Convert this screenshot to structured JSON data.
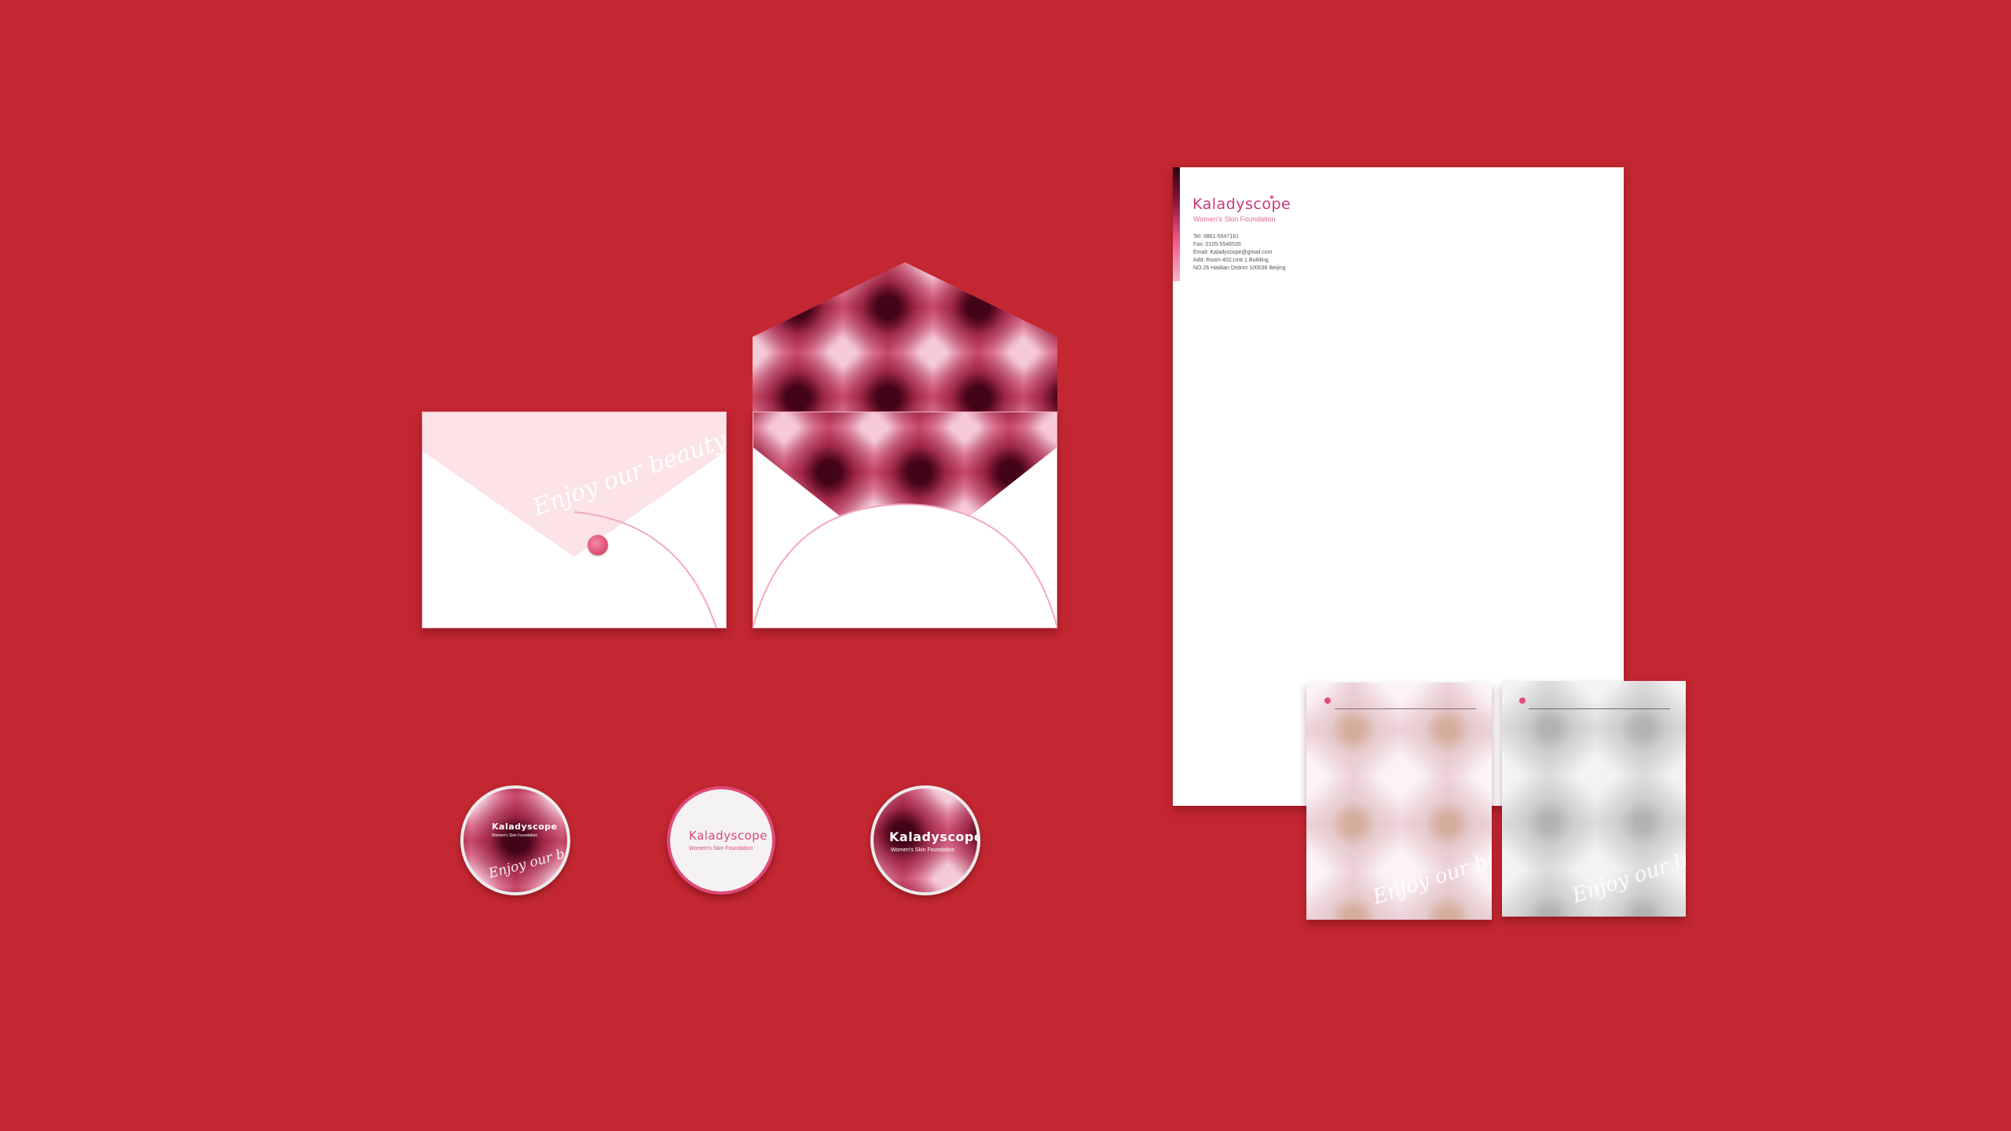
{
  "brand": {
    "name": "Kaladyscope",
    "tagline": "Women's Skin Foundation",
    "slogan": "Enjoy our beauty",
    "colors": {
      "background": "#c32731",
      "pink": "#e64a7a",
      "light_pink": "#fbe3e8",
      "white": "#ffffff"
    }
  },
  "letterhead": {
    "contact": [
      "Tel: 0861-5547161",
      "Fax: 0105-5546535",
      "Email: Kaladyscope@gmail.com",
      "Add: Room 402,Unit 1 Building",
      "NO.26 Haidian District 100038 Beijing"
    ]
  },
  "icons": {
    "seal": "circle-seal-icon",
    "dot": "pink-dot-icon"
  }
}
